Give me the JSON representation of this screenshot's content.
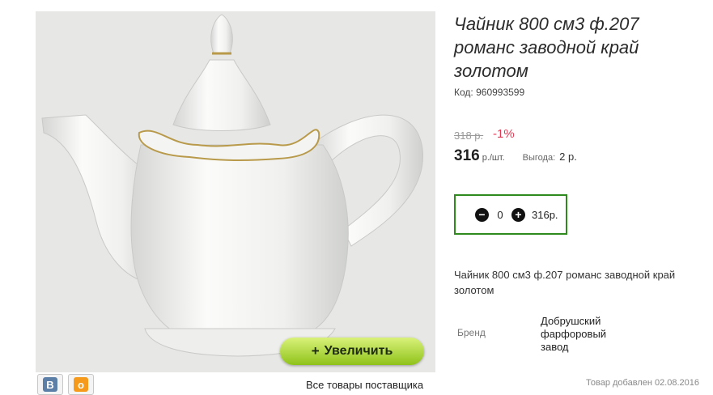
{
  "product": {
    "title": "Чайник 800 см3 ф.207 романс заводной край золотом",
    "code_label": "Код:",
    "code_value": "960993599",
    "old_price": "318 р.",
    "discount": "-1%",
    "price": "316",
    "price_unit": "р./шт.",
    "benefit_label": "Выгода:",
    "benefit_value": "2 р.",
    "description": "Чайник 800 см3 ф.207 романс заводной край золотом",
    "brand_label": "Бренд",
    "brand_value": "Добрушский фарфоровый завод",
    "added_text": "Товар добавлен 02.08.2016"
  },
  "cart": {
    "minus_icon": "minus-circle-icon",
    "quantity": "0",
    "plus_icon": "plus-circle-icon",
    "sum": "316р."
  },
  "gallery": {
    "zoom_plus": "+",
    "zoom_label": "Увеличить",
    "supplier_link": "Все товары поставщика"
  },
  "social": {
    "vk_glyph": "В",
    "ok_glyph": "о"
  },
  "colors": {
    "accent_green": "#2f8a1e",
    "discount_red": "#e03a55",
    "zoom_button": "#8fc21a"
  }
}
